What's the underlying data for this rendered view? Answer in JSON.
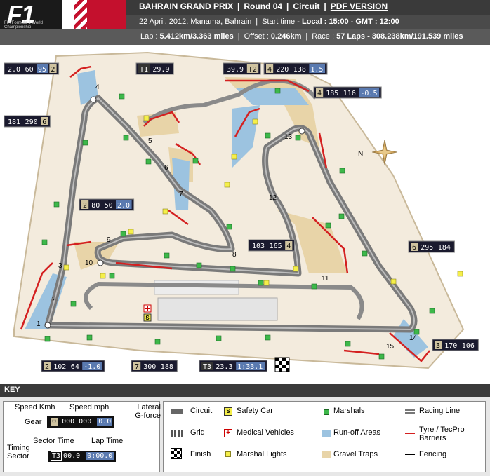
{
  "header": {
    "title": "BAHRAIN GRAND PRIX",
    "round": "Round 04",
    "circuit": "Circuit",
    "pdf": "PDF VERSION",
    "date_place": "22 April, 2012. Manama, Bahrain",
    "start_label": "Start time",
    "start_value": "Local : 15:00 - GMT : 12:00",
    "lap_label": "Lap :",
    "lap_value": "5.412km/3.363 miles",
    "offset_label": "Offset :",
    "offset_value": "0.246km",
    "race_label": "Race :",
    "race_value": "57 Laps - 308.238km/191.539 miles",
    "logo_text": "F1",
    "logo_sub": "FIA Formula 1 World Championship"
  },
  "compass": "N",
  "turns": [
    "1",
    "2",
    "3",
    "4",
    "5",
    "6",
    "7",
    "8",
    "9",
    "10",
    "11",
    "12",
    "13",
    "14",
    "15"
  ],
  "telemetry": [
    {
      "speed_kmh": "2.0",
      "speed_mph": "60",
      "lat": "95",
      "gear": "2"
    },
    {
      "speed_kmh": "181",
      "speed_mph": "290",
      "gear": "6"
    },
    {
      "tag": "T1",
      "time": "29.9"
    },
    {
      "time": "39.9",
      "tag": "T2"
    },
    {
      "gear": "4",
      "speed_kmh": "220",
      "speed_mph": "138",
      "lat": "1.5"
    },
    {
      "gear": "4",
      "speed_kmh": "185",
      "speed_mph": "116",
      "lat": "-0.5"
    },
    {
      "gear": "2",
      "speed_kmh": "80",
      "speed_mph": "50",
      "lat": "2.0"
    },
    {
      "speed_kmh": "103",
      "speed_mph": "165",
      "gear": "4"
    },
    {
      "gear": "6",
      "speed_kmh": "295",
      "speed_mph": "184"
    },
    {
      "gear": "2",
      "speed_kmh": "102",
      "speed_mph": "64",
      "lat": "-1.0"
    },
    {
      "gear": "7",
      "speed_kmh": "300",
      "speed_mph": "188"
    },
    {
      "tag": "T3",
      "time": "23.3",
      "lap": "1:33.1"
    },
    {
      "gear": "3",
      "speed_kmh": "170",
      "speed_mph": "106"
    }
  ],
  "key": {
    "title": "KEY",
    "speed_kmh": "Speed Kmh",
    "speed_mph": "Speed mph",
    "lateral": "Lateral G-force",
    "gear": "Gear",
    "sample_gear": "0",
    "sample_kmh": "000",
    "sample_mph": "000",
    "sample_lat": "0.0",
    "sector_time": "Sector Time",
    "lap_time": "Lap Time",
    "timing_sector": "Timing Sector",
    "sample_tag": "T3",
    "sample_sector": "00.0",
    "sample_lap": "0:00.0",
    "items": {
      "circuit": "Circuit",
      "grid": "Grid",
      "finish": "Finish",
      "safety_car": "Safety Car",
      "medical": "Medical Vehicles",
      "marshal_lights": "Marshal Lights",
      "marshals": "Marshals",
      "runoff": "Run-off Areas",
      "gravel": "Gravel Traps",
      "racing_line": "Racing Line",
      "tyre": "Tyre / TecPro Barriers",
      "fencing": "Fencing"
    }
  },
  "colors": {
    "gravel": "#e8d4a8",
    "runoff": "#9cc3e0",
    "marshal": "#3db84a",
    "light": "#f5ef4a",
    "barrier": "#d42020",
    "track": "#777777"
  }
}
